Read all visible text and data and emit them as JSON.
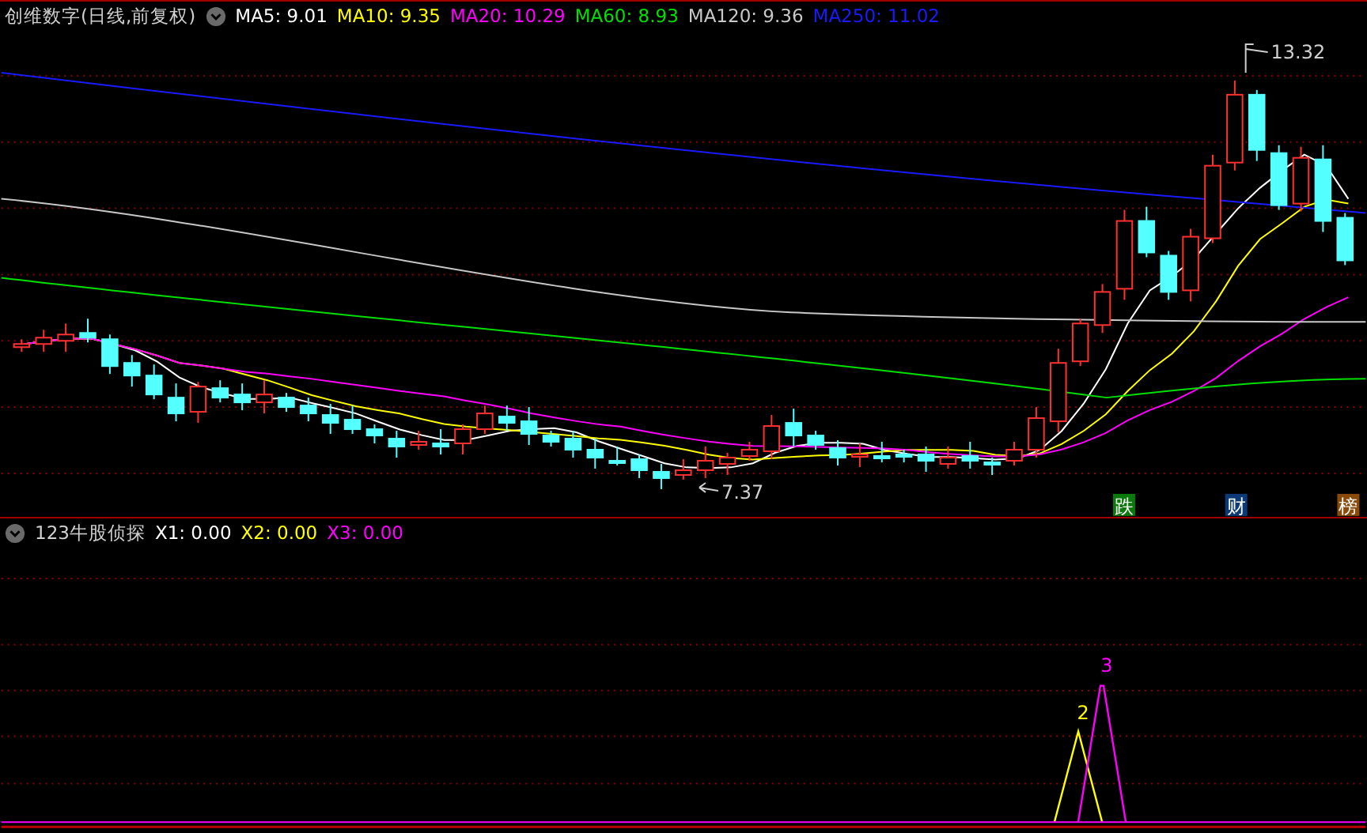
{
  "main_panel": {
    "title": "创维数字(日线,前复权)",
    "legend": [
      {
        "label": "MA5: 9.01",
        "color": "#ffffff"
      },
      {
        "label": "MA10: 9.35",
        "color": "#ffff00"
      },
      {
        "label": "MA20: 10.29",
        "color": "#ff00ff"
      },
      {
        "label": "MA60: 8.93",
        "color": "#00e000"
      },
      {
        "label": "MA120: 9.36",
        "color": "#c8c8c8"
      },
      {
        "label": "MA250: 11.02",
        "color": "#1a1aff"
      }
    ],
    "high_label": "13.32",
    "low_label": "7.37",
    "markers": [
      {
        "text": "跌",
        "color": "#0a7a0a"
      },
      {
        "text": "财",
        "color": "#0c3a78"
      },
      {
        "text": "榜",
        "color": "#8a4a0a"
      }
    ]
  },
  "indicator_panel": {
    "title": "123牛股侦探",
    "legend": [
      {
        "label": "X1: 0.00",
        "color": "#ffffff"
      },
      {
        "label": "X2: 0.00",
        "color": "#ffff00"
      },
      {
        "label": "X3: 0.00",
        "color": "#ff00ff"
      }
    ],
    "peak_labels": [
      {
        "text": "2",
        "color": "#ffff00"
      },
      {
        "text": "3",
        "color": "#ff00ff"
      }
    ]
  }
}
